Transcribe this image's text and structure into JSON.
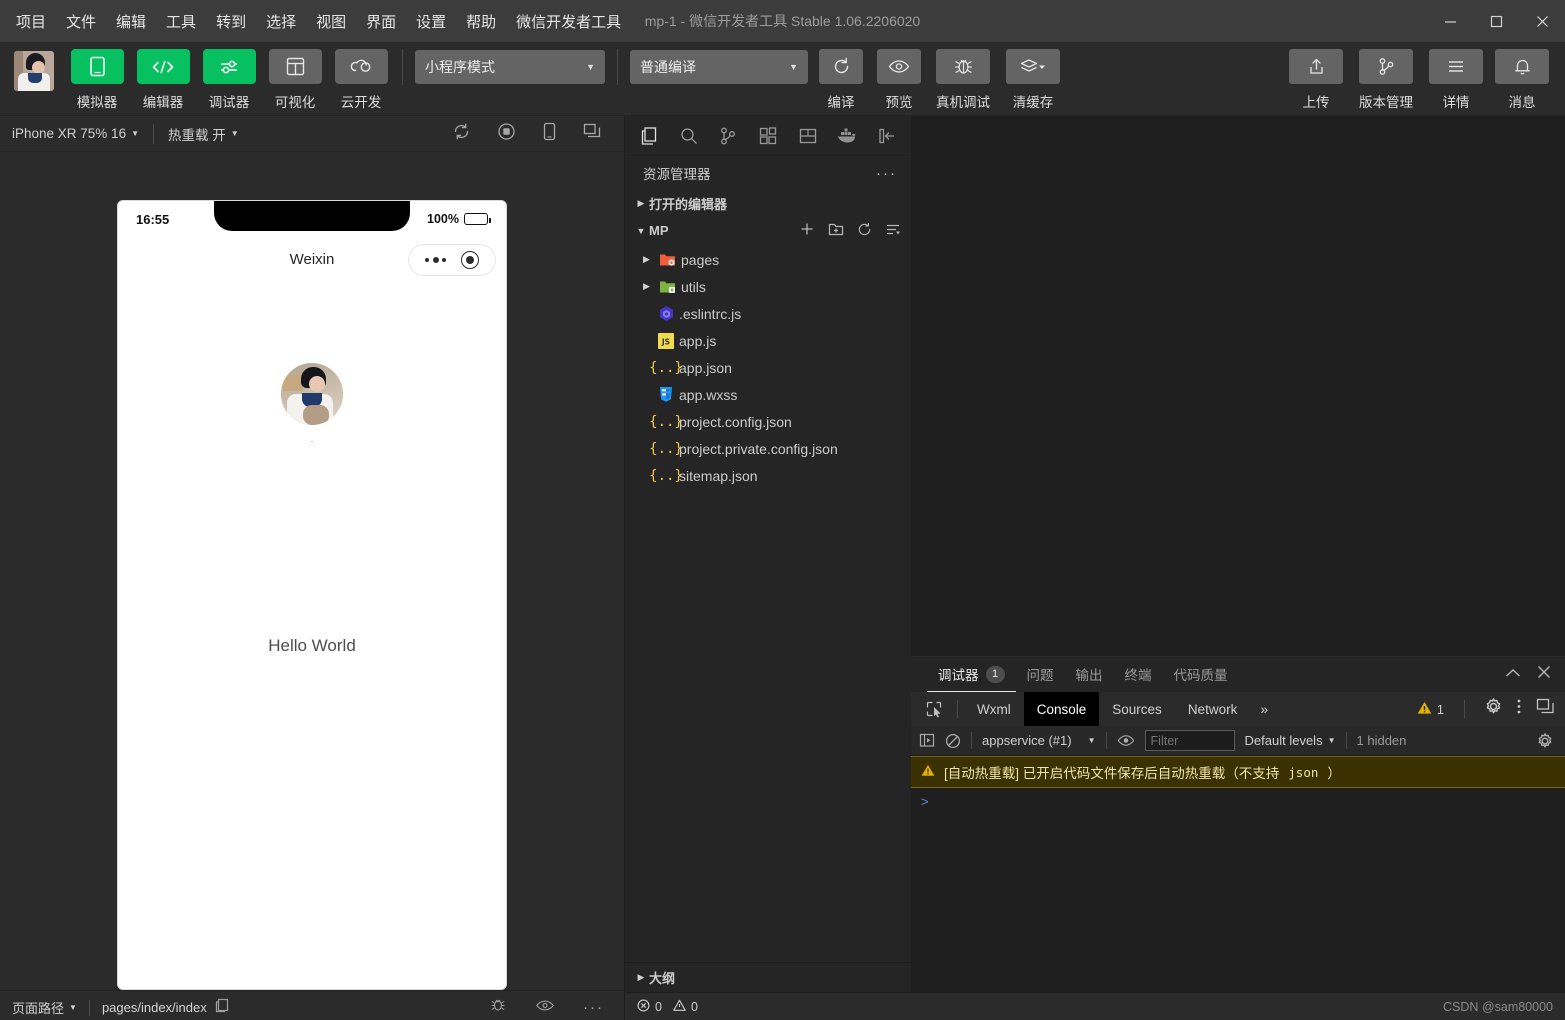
{
  "window": {
    "title": "mp-1 - 微信开发者工具 Stable 1.06.2206020",
    "minimize": "−",
    "maximize": "□",
    "close": "✕"
  },
  "menubar": {
    "items": [
      {
        "label": "项目",
        "name": "menu-project"
      },
      {
        "label": "文件",
        "name": "menu-file"
      },
      {
        "label": "编辑",
        "name": "menu-edit"
      },
      {
        "label": "工具",
        "name": "menu-tools"
      },
      {
        "label": "转到",
        "name": "menu-goto"
      },
      {
        "label": "选择",
        "name": "menu-select"
      },
      {
        "label": "视图",
        "name": "menu-view"
      },
      {
        "label": "界面",
        "name": "menu-ui"
      },
      {
        "label": "设置",
        "name": "menu-settings"
      },
      {
        "label": "帮助",
        "name": "menu-help"
      },
      {
        "label": "微信开发者工具",
        "name": "menu-devtools"
      }
    ]
  },
  "toolbar": {
    "panels": [
      {
        "label": "模拟器",
        "icon": "phone-icon",
        "active": true
      },
      {
        "label": "编辑器",
        "icon": "code-icon",
        "active": true
      },
      {
        "label": "调试器",
        "icon": "sliders-icon",
        "active": true
      },
      {
        "label": "可视化",
        "icon": "layout-icon",
        "active": false
      },
      {
        "label": "云开发",
        "icon": "cloud-icon",
        "active": false
      }
    ],
    "mode_select": "小程序模式",
    "compile_select": "普通编译",
    "actions": [
      {
        "label": "编译",
        "icon": "refresh-icon"
      },
      {
        "label": "预览",
        "icon": "eye-icon"
      },
      {
        "label": "真机调试",
        "icon": "bug-icon"
      },
      {
        "label": "清缓存",
        "icon": "layers-icon"
      }
    ],
    "right_actions": [
      {
        "label": "上传",
        "icon": "upload-icon"
      },
      {
        "label": "版本管理",
        "icon": "branch-icon"
      },
      {
        "label": "详情",
        "icon": "menu-lines-icon"
      },
      {
        "label": "消息",
        "icon": "bell-icon"
      }
    ]
  },
  "simulator": {
    "device_select": "iPhone XR 75% 16",
    "hotreload_select": "热重载 开",
    "toolbar_icons": [
      "refresh-icon",
      "record-icon",
      "device-icon",
      "detach-icon"
    ],
    "phone": {
      "time": "16:55",
      "battery": "100%",
      "nav_title": "Weixin",
      "nickname": "·",
      "hello_text": "Hello World"
    },
    "status": {
      "page_path_label": "页面路径",
      "page_path": "pages/index/index",
      "icons": [
        "bug-icon",
        "eye-icon",
        "more-icon"
      ]
    }
  },
  "explorer": {
    "activity_icons": [
      {
        "name": "files-icon",
        "active": true
      },
      {
        "name": "search-icon",
        "active": false
      },
      {
        "name": "source-control-icon",
        "active": false
      },
      {
        "name": "extensions-icon",
        "active": false
      },
      {
        "name": "layout-panel-icon",
        "active": false
      },
      {
        "name": "docker-icon",
        "active": false
      },
      {
        "name": "collapse-sidebar-icon",
        "active": false
      }
    ],
    "title": "资源管理器",
    "more": "···",
    "open_editors": "打开的编辑器",
    "project_name": "MP",
    "project_actions": [
      "new-file-icon",
      "new-folder-icon",
      "refresh-icon",
      "collapse-all-icon"
    ],
    "tree": [
      {
        "label": "pages",
        "type": "folder",
        "icon": "folder-orange-icon",
        "expanded": false
      },
      {
        "label": "utils",
        "type": "folder",
        "icon": "folder-green-icon",
        "expanded": false
      },
      {
        "label": ".eslintrc.js",
        "type": "file",
        "icon": "eslint-icon"
      },
      {
        "label": "app.js",
        "type": "file",
        "icon": "js-icon"
      },
      {
        "label": "app.json",
        "type": "file",
        "icon": "json-icon"
      },
      {
        "label": "app.wxss",
        "type": "file",
        "icon": "css-icon"
      },
      {
        "label": "project.config.json",
        "type": "file",
        "icon": "json-icon"
      },
      {
        "label": "project.private.config.json",
        "type": "file",
        "icon": "json-icon"
      },
      {
        "label": "sitemap.json",
        "type": "file",
        "icon": "json-icon"
      }
    ],
    "outline": "大纲"
  },
  "panel": {
    "tabs": [
      {
        "label": "调试器",
        "badge": "1",
        "active": true
      },
      {
        "label": "问题",
        "badge": "",
        "active": false
      },
      {
        "label": "输出",
        "badge": "",
        "active": false
      },
      {
        "label": "终端",
        "badge": "",
        "active": false
      },
      {
        "label": "代码质量",
        "badge": "",
        "active": false
      }
    ],
    "collapse_icon": "chevron-up-icon",
    "close_icon": "close-icon",
    "devtools_tabs": [
      {
        "label": "Wxml",
        "active": false
      },
      {
        "label": "Console",
        "active": true
      },
      {
        "label": "Sources",
        "active": false
      },
      {
        "label": "Network",
        "active": false
      }
    ],
    "devtools_more": "»",
    "warning_count": "1",
    "console": {
      "context": "appservice (#1)",
      "filter_placeholder": "Filter",
      "filter_value": "",
      "levels": "Default levels",
      "hidden": "1 hidden",
      "messages": [
        {
          "type": "warning",
          "text": "[自动热重载] 已开启代码文件保存后自动热重载（不支持 ",
          "mono": "json",
          "suffix": "）"
        }
      ],
      "prompt": ">"
    }
  },
  "bottom_status": {
    "errors": "0",
    "warnings": "0",
    "watermark": "CSDN @sam80000"
  },
  "colors": {
    "accent_green": "#07c160",
    "titlebar": "#3c3c3c",
    "toolbar": "#2b2b2b",
    "sidebar": "#252526",
    "editor": "#1e1e1e",
    "warning_yellow": "#e2b203"
  }
}
